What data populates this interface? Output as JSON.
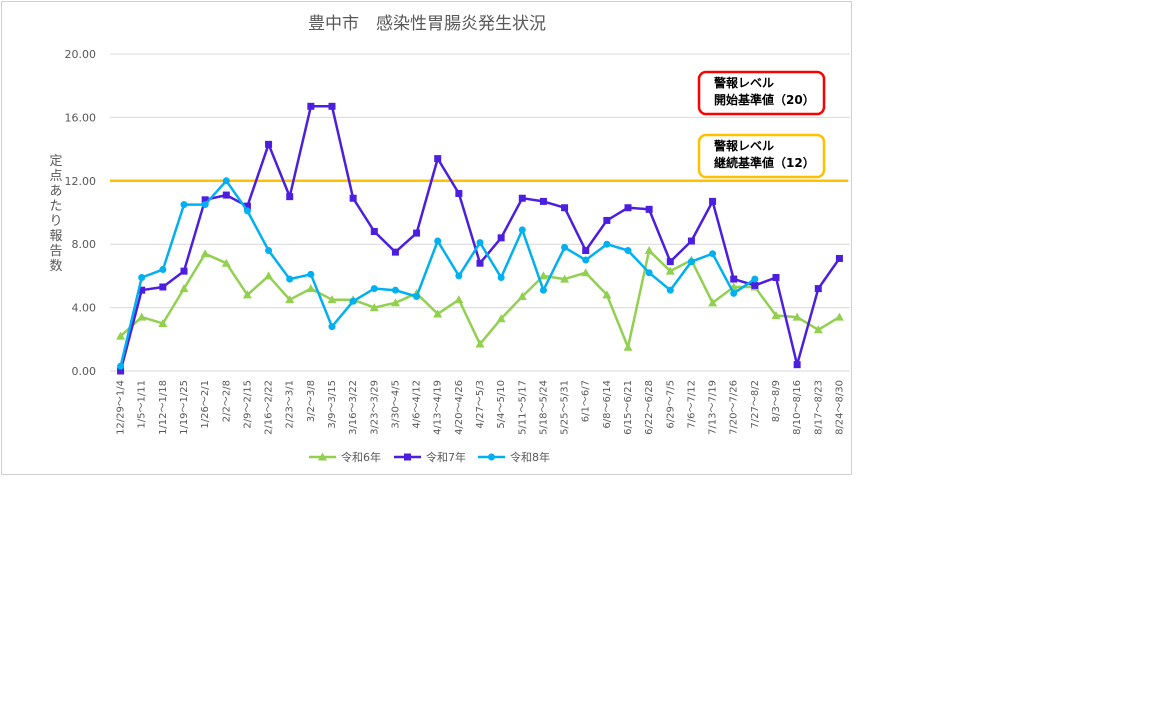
{
  "chart_data": {
    "type": "line",
    "title": "豊中市　感染性胃腸炎発生状況",
    "xlabel": "",
    "ylabel": "定点あたり報告数",
    "ylim": [
      0,
      20
    ],
    "yticks": [
      "0.00",
      "4.00",
      "8.00",
      "12.00",
      "16.00",
      "20.00"
    ],
    "grid": true,
    "legend_position": "bottom",
    "categories": [
      "12/29～1/4",
      "1/5～1/11",
      "1/12～1/18",
      "1/19～1/25",
      "1/26～2/1",
      "2/2～2/8",
      "2/9～2/15",
      "2/16～2/22",
      "2/23～3/1",
      "3/2～3/8",
      "3/9～3/15",
      "3/16～3/22",
      "3/23～3/29",
      "3/30～4/5",
      "4/6～4/12",
      "4/13～4/19",
      "4/20～4/26",
      "4/27～5/3",
      "5/4～5/10",
      "5/11～5/17",
      "5/18～5/24",
      "5/25～5/31",
      "6/1～6/7",
      "6/8～6/14",
      "6/15～6/21",
      "6/22～6/28",
      "6/29～7/5",
      "7/6～7/12",
      "7/13～7/19",
      "7/20～7/26",
      "7/27～8/2",
      "8/3～8/9",
      "8/10～8/16",
      "8/17～8/23",
      "8/24～8/30"
    ],
    "series": [
      {
        "name": "令和6年",
        "color": "#92d050",
        "marker": "triangle",
        "values": [
          2.2,
          3.4,
          3.0,
          5.2,
          7.4,
          6.8,
          4.8,
          6.0,
          4.5,
          5.2,
          4.5,
          4.5,
          4.0,
          4.3,
          4.9,
          3.6,
          4.5,
          1.7,
          3.3,
          4.7,
          6.0,
          5.8,
          6.2,
          4.8,
          1.5,
          7.6,
          6.3,
          7.0,
          4.3,
          5.3,
          5.3,
          3.5,
          3.4,
          2.6,
          3.4
        ]
      },
      {
        "name": "令和7年",
        "color": "#4b1ee0",
        "marker": "square",
        "values": [
          0.0,
          5.1,
          5.3,
          6.3,
          10.8,
          11.1,
          10.4,
          14.3,
          11.0,
          16.7,
          16.7,
          10.9,
          8.8,
          7.5,
          8.7,
          13.4,
          11.2,
          6.8,
          8.4,
          10.9,
          10.7,
          10.3,
          7.6,
          9.5,
          10.3,
          10.2,
          6.9,
          8.2,
          10.7,
          5.8,
          5.4,
          5.9,
          0.4,
          5.2,
          7.1
        ]
      },
      {
        "name": "令和8年",
        "color": "#00b0f0",
        "marker": "circle",
        "values": [
          0.3,
          5.9,
          6.4,
          10.5,
          10.5,
          12.0,
          10.1,
          7.6,
          5.8,
          6.1,
          2.8,
          4.4,
          5.2,
          5.1,
          4.7,
          8.2,
          6.0,
          8.1,
          5.9,
          8.9,
          5.1,
          7.8,
          7.0,
          8.0,
          7.6,
          6.2,
          5.1,
          6.9,
          7.4,
          4.9,
          5.8,
          null,
          null,
          null,
          null
        ]
      }
    ],
    "reference_lines": [
      {
        "value": 12,
        "color": "#ffc000"
      }
    ],
    "annotations": [
      {
        "lines": [
          "警報レベル",
          "開始基準値（20）"
        ],
        "border_color": "#ff0000"
      },
      {
        "lines": [
          "警報レベル",
          "継続基準値（12）"
        ],
        "border_color": "#ffc000"
      }
    ]
  }
}
